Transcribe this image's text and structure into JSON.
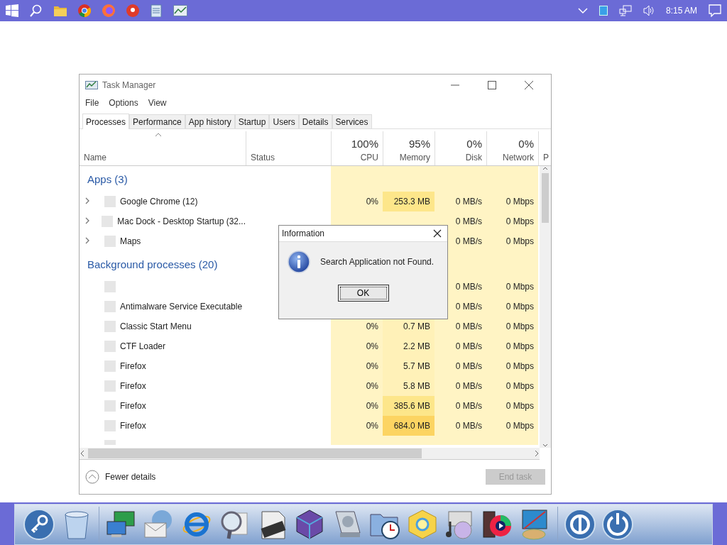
{
  "taskbar": {
    "clock": "8:15 AM"
  },
  "window": {
    "title": "Task Manager"
  },
  "menu": [
    "File",
    "Options",
    "View"
  ],
  "tabs": [
    {
      "label": "Processes",
      "selected": true
    },
    {
      "label": "Performance",
      "selected": false
    },
    {
      "label": "App history",
      "selected": false
    },
    {
      "label": "Startup",
      "selected": false
    },
    {
      "label": "Users",
      "selected": false
    },
    {
      "label": "Details",
      "selected": false
    },
    {
      "label": "Services",
      "selected": false
    }
  ],
  "table": {
    "columns": [
      {
        "label": "Name"
      },
      {
        "label": "Status"
      },
      {
        "label": "CPU",
        "reading": "100%"
      },
      {
        "label": "Memory",
        "reading": "95%"
      },
      {
        "label": "Disk",
        "reading": "0%"
      },
      {
        "label": "Network",
        "reading": "0%"
      },
      {
        "label": "P"
      }
    ],
    "groups": [
      {
        "heading": "Apps (3)",
        "rows": [
          {
            "name": "Google Chrome (12)",
            "expandable": true,
            "cpu": "0%",
            "memory": "253.3 MB",
            "disk": "0 MB/s",
            "network": "0 Mbps",
            "color": "#fde68a"
          },
          {
            "name": "Mac Dock - Desktop Startup (32...",
            "expandable": true,
            "disk": "0 MB/s",
            "network": "0 Mbps",
            "color": "#fff4c4"
          },
          {
            "name": "Maps",
            "expandable": true,
            "disk": "0 MB/s",
            "network": "0 Mbps"
          }
        ]
      },
      {
        "heading": "Background processes (20)",
        "rows": [
          {
            "expandable": false,
            "disk": "0 MB/s",
            "network": "0 Mbps"
          },
          {
            "name": "Antimalware Service Executable",
            "expandable": false,
            "disk": "0 MB/s",
            "network": "0 Mbps"
          },
          {
            "name": "Classic Start Menu",
            "expandable": false,
            "cpu": "0%",
            "memory": "0.7 MB",
            "disk": "0 MB/s",
            "network": "0 Mbps",
            "color": "#fff1b8"
          },
          {
            "name": "CTF Loader",
            "expandable": false,
            "cpu": "0%",
            "memory": "2.2 MB",
            "disk": "0 MB/s",
            "network": "0 Mbps",
            "color": "#fff1b8"
          },
          {
            "name": "Firefox",
            "expandable": false,
            "cpu": "0%",
            "memory": "5.7 MB",
            "disk": "0 MB/s",
            "network": "0 Mbps",
            "color": "#fff1b8"
          },
          {
            "name": "Firefox",
            "expandable": false,
            "cpu": "0%",
            "memory": "5.8 MB",
            "disk": "0 MB/s",
            "network": "0 Mbps",
            "color": "#fff1b8"
          },
          {
            "name": "Firefox",
            "expandable": false,
            "cpu": "0%",
            "memory": "385.6 MB",
            "disk": "0 MB/s",
            "network": "0 Mbps",
            "color": "#fde68a"
          },
          {
            "name": "Firefox",
            "expandable": false,
            "cpu": "0%",
            "memory": "684.0 MB",
            "disk": "0 MB/s",
            "network": "0 Mbps",
            "color": "#fcd462"
          }
        ]
      }
    ]
  },
  "footer": {
    "toggle": "Fewer details",
    "button": {
      "label": "End task",
      "disabled": true
    }
  },
  "dialog": {
    "title": "Information",
    "message": "Search Application not Found.",
    "button": "OK"
  }
}
